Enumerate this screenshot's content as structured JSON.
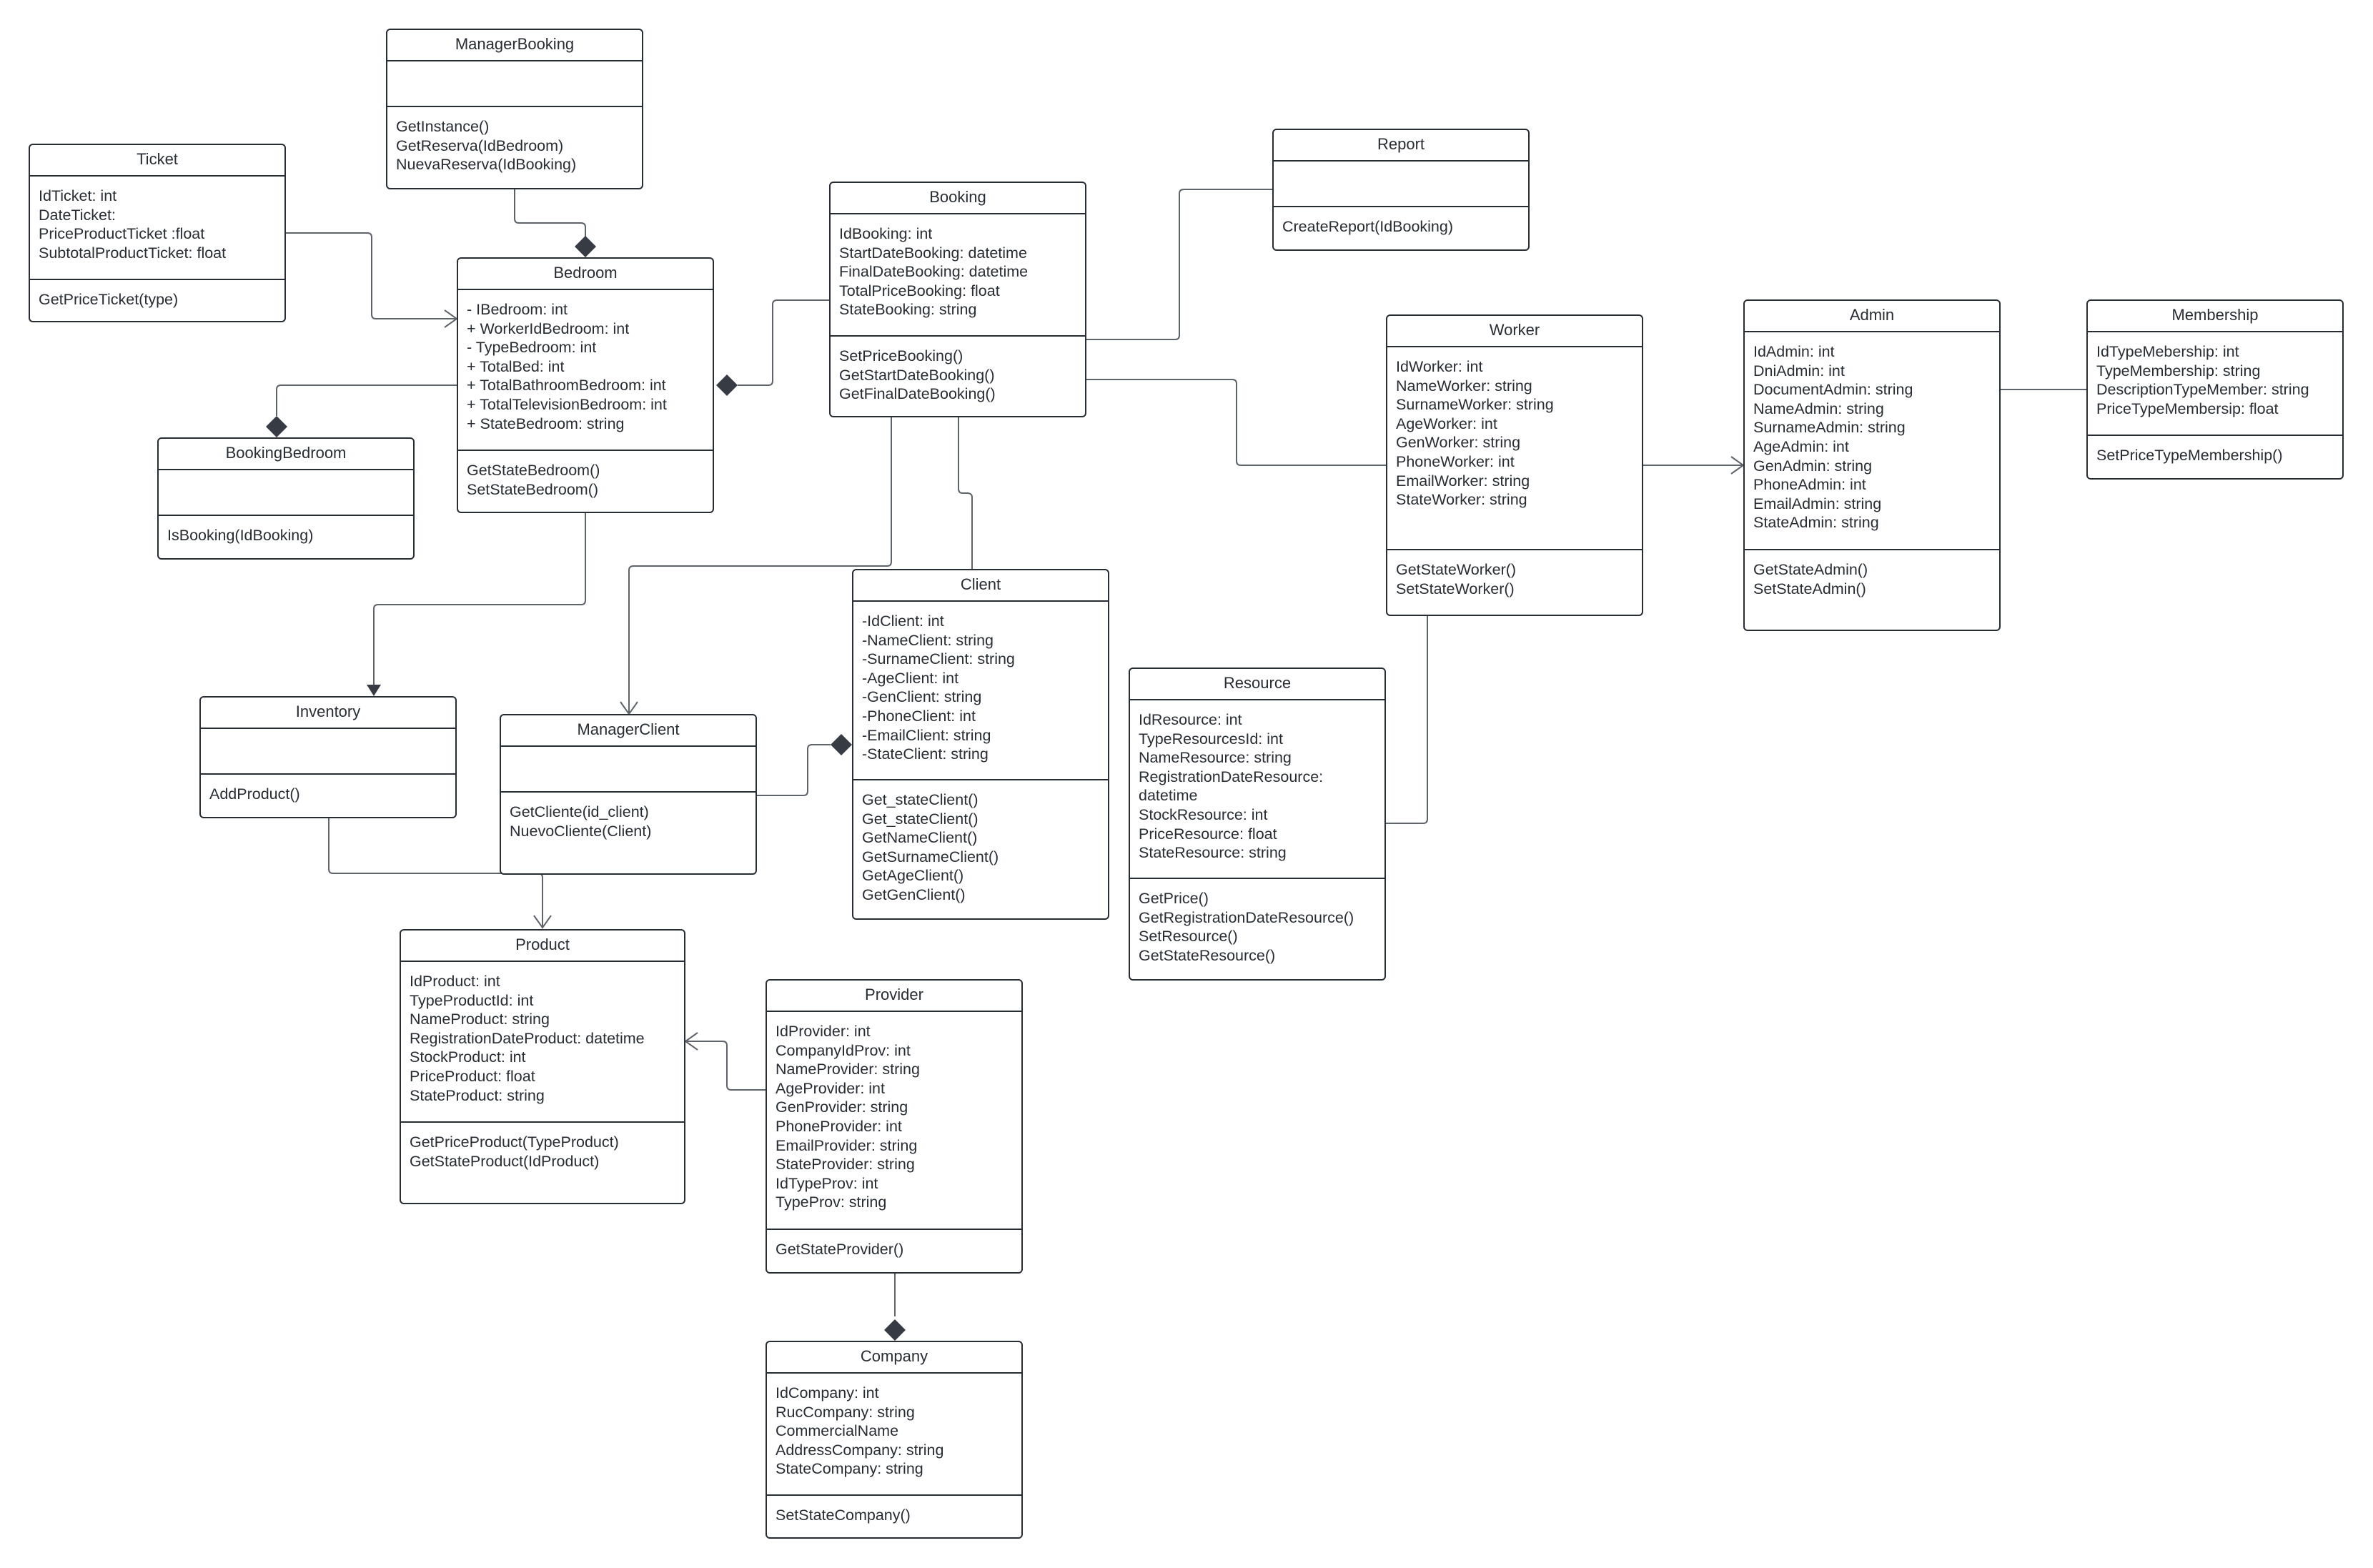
{
  "diagram": {
    "type": "UML class diagram",
    "classes": {
      "managerBooking": {
        "name": "ManagerBooking",
        "attributes": [],
        "methods": [
          "GetInstance()",
          "GetReserva(IdBedroom)",
          "NuevaReserva(IdBooking)"
        ]
      },
      "ticket": {
        "name": "Ticket",
        "attributes": [
          "IdTicket: int",
          "DateTicket:",
          "PriceProductTicket :float",
          "SubtotalProductTicket: float"
        ],
        "methods": [
          "GetPriceTicket(type)"
        ]
      },
      "bedroom": {
        "name": "Bedroom",
        "attributes": [
          "- IBedroom: int",
          "+ WorkerIdBedroom: int",
          "- TypeBedroom: int",
          "+ TotalBed: int",
          "+ TotalBathroomBedroom: int",
          "+ TotalTelevisionBedroom: int",
          "+ StateBedroom: string"
        ],
        "methods": [
          "GetStateBedroom()",
          "SetStateBedroom()"
        ]
      },
      "booking": {
        "name": "Booking",
        "attributes": [
          "IdBooking: int",
          "StartDateBooking: datetime",
          "FinalDateBooking: datetime",
          "TotalPriceBooking: float",
          "StateBooking: string"
        ],
        "methods": [
          "SetPriceBooking()",
          "GetStartDateBooking()",
          "GetFinalDateBooking()"
        ]
      },
      "report": {
        "name": "Report",
        "attributes": [],
        "methods": [
          "CreateReport(IdBooking)"
        ]
      },
      "worker": {
        "name": "Worker",
        "attributes": [
          "IdWorker: int",
          "NameWorker: string",
          "SurnameWorker: string",
          "AgeWorker: int",
          "GenWorker: string",
          "PhoneWorker: int",
          "EmailWorker: string",
          "StateWorker: string"
        ],
        "methods": [
          "GetStateWorker()",
          "SetStateWorker()"
        ]
      },
      "admin": {
        "name": "Admin",
        "attributes": [
          "IdAdmin: int",
          "DniAdmin:  int",
          "DocumentAdmin: string",
          "NameAdmin: string",
          "SurnameAdmin: string",
          "AgeAdmin: int",
          "GenAdmin: string",
          "PhoneAdmin: int",
          "EmailAdmin: string",
          "StateAdmin: string"
        ],
        "methods": [
          "GetStateAdmin()",
          "SetStateAdmin()"
        ]
      },
      "membership": {
        "name": "Membership",
        "attributes": [
          "IdTypeMebership: int",
          "TypeMembership: string",
          "DescriptionTypeMember: string",
          "PriceTypeMembersip: float"
        ],
        "methods": [
          "SetPriceTypeMembership()"
        ]
      },
      "bookingBedroom": {
        "name": "BookingBedroom",
        "attributes": [],
        "methods": [
          "IsBooking(IdBooking)"
        ]
      },
      "inventory": {
        "name": "Inventory",
        "attributes": [],
        "methods": [
          "AddProduct()"
        ]
      },
      "managerClient": {
        "name": "ManagerClient",
        "attributes": [],
        "methods": [
          "GetCliente(id_client)",
          "NuevoCliente(Client)"
        ]
      },
      "client": {
        "name": "Client",
        "attributes": [
          "-IdClient: int",
          "-NameClient: string",
          "-SurnameClient: string",
          "-AgeClient: int",
          "-GenClient: string",
          "-PhoneClient: int",
          "-EmailClient: string",
          "-StateClient: string"
        ],
        "methods": [
          "Get_stateClient()",
          "Get_stateClient()",
          "GetNameClient()",
          "GetSurnameClient()",
          "GetAgeClient()",
          "GetGenClient()"
        ]
      },
      "resource": {
        "name": "Resource",
        "attributes": [
          "IdResource: int",
          "TypeResourcesId: int",
          "NameResource: string",
          "RegistrationDateResource:",
          "datetime",
          "StockResource: int",
          "PriceResource: float",
          "StateResource: string"
        ],
        "methods": [
          "GetPrice()",
          "GetRegistrationDateResource()",
          "SetResource()",
          "GetStateResource()"
        ]
      },
      "product": {
        "name": "Product",
        "attributes": [
          "IdProduct: int",
          "TypeProductId: int",
          "NameProduct: string",
          "RegistrationDateProduct: datetime",
          "StockProduct: int",
          "PriceProduct: float",
          "StateProduct: string"
        ],
        "methods": [
          "GetPriceProduct(TypeProduct)",
          "GetStateProduct(IdProduct)"
        ]
      },
      "provider": {
        "name": "Provider",
        "attributes": [
          "IdProvider: int",
          "CompanyIdProv: int",
          "NameProvider: string",
          "AgeProvider: int",
          "GenProvider: string",
          "PhoneProvider: int",
          "EmailProvider: string",
          "StateProvider: string",
          "IdTypeProv: int",
          "TypeProv: string"
        ],
        "methods": [
          "GetStateProvider()"
        ]
      },
      "company": {
        "name": "Company",
        "attributes": [
          "IdCompany: int",
          "RucCompany: string",
          "CommercialName",
          "AddressCompany: string",
          "StateCompany: string"
        ],
        "methods": [
          "SetStateCompany()"
        ]
      }
    },
    "relationships": [
      {
        "from": "ManagerBooking",
        "to": "Bedroom",
        "kind": "composition"
      },
      {
        "from": "Ticket",
        "to": "Bedroom",
        "kind": "association-arrow"
      },
      {
        "from": "Booking",
        "to": "Bedroom",
        "kind": "composition"
      },
      {
        "from": "Bedroom",
        "to": "BookingBedroom",
        "kind": "composition"
      },
      {
        "from": "Bedroom",
        "to": "Inventory",
        "kind": "directed-association"
      },
      {
        "from": "Booking",
        "to": "Report",
        "kind": "association"
      },
      {
        "from": "Booking",
        "to": "Worker",
        "kind": "association"
      },
      {
        "from": "Booking",
        "to": "ManagerClient",
        "kind": "association-arrow"
      },
      {
        "from": "Booking",
        "to": "Client",
        "kind": "association"
      },
      {
        "from": "ManagerClient",
        "to": "Client",
        "kind": "composition"
      },
      {
        "from": "Worker",
        "to": "Admin",
        "kind": "association-arrow"
      },
      {
        "from": "Admin",
        "to": "Membership",
        "kind": "association"
      },
      {
        "from": "Worker",
        "to": "Resource",
        "kind": "association"
      },
      {
        "from": "Inventory",
        "to": "Product",
        "kind": "association-arrow"
      },
      {
        "from": "Provider",
        "to": "Product",
        "kind": "association-arrow"
      },
      {
        "from": "Provider",
        "to": "Company",
        "kind": "composition"
      }
    ],
    "colors": {
      "stroke": "#282c33",
      "connector": "#6b6f76",
      "background": "#ffffff"
    }
  }
}
